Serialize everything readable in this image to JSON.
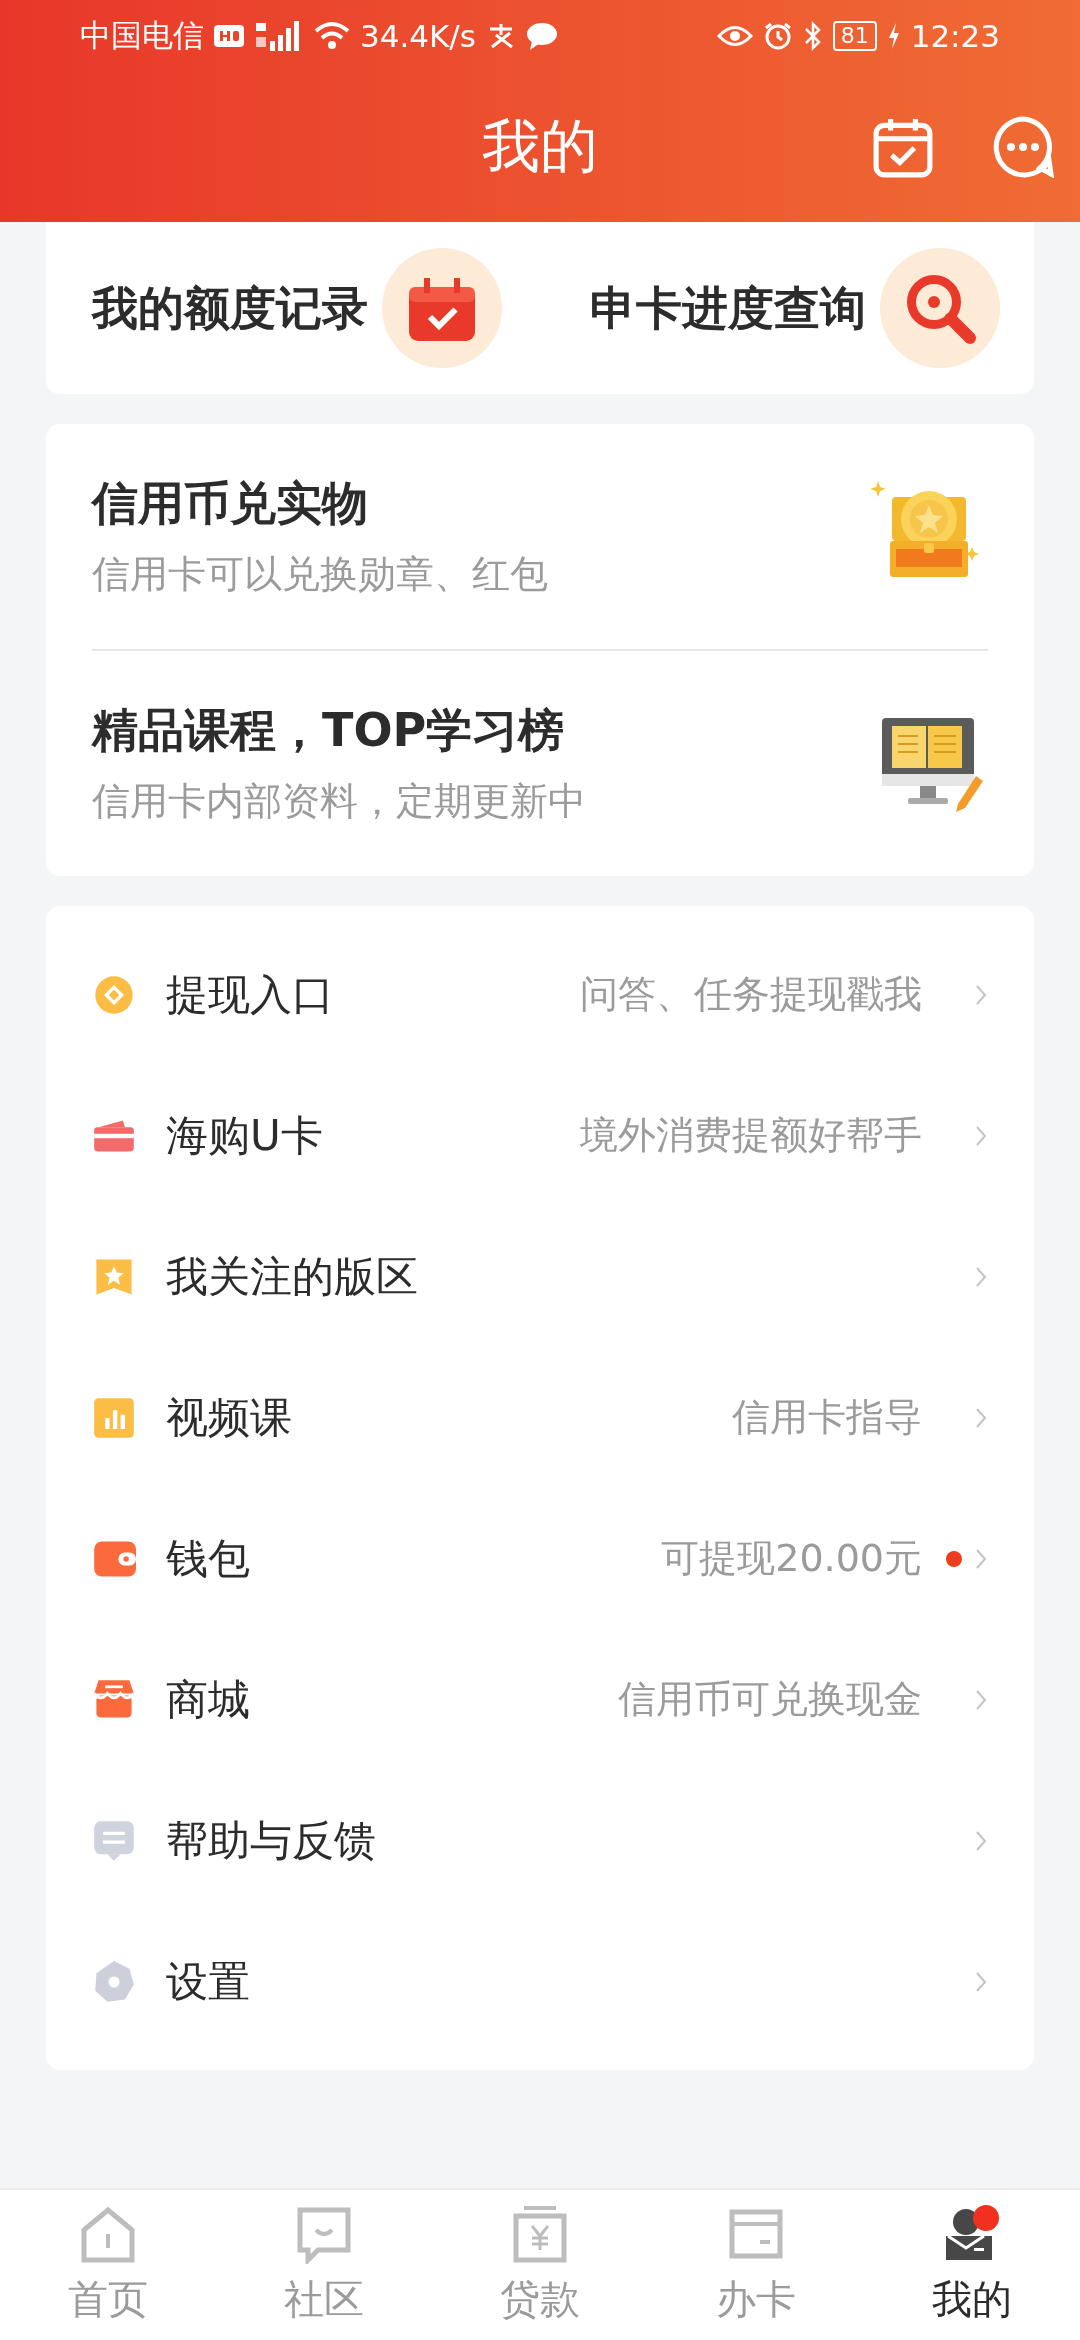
{
  "status_bar": {
    "carrier": "中国电信",
    "speed": "34.4K/s",
    "battery": "81",
    "time": "12:23"
  },
  "header": {
    "title": "我的"
  },
  "quick_cards": [
    {
      "title": "我的额度记录"
    },
    {
      "title": "申卡进度查询"
    }
  ],
  "promos": [
    {
      "title": "信用币兑实物",
      "subtitle": "信用卡可以兑换勋章、红包"
    },
    {
      "title": "精品课程，TOP学习榜",
      "subtitle": "信用卡内部资料，定期更新中"
    }
  ],
  "menu": [
    {
      "label": "提现入口",
      "hint": "问答、任务提现戳我",
      "dot": false
    },
    {
      "label": "海购U卡",
      "hint": "境外消费提额好帮手",
      "dot": false
    },
    {
      "label": "我关注的版区",
      "dot": false
    },
    {
      "label": "视频课",
      "hint": "信用卡指导",
      "dot": false
    },
    {
      "label": "钱包",
      "hint": "可提现20.00元",
      "dot": true
    },
    {
      "label": "商城",
      "hint": "信用币可兑换现金",
      "dot": false
    },
    {
      "label": "帮助与反馈",
      "dot": false
    },
    {
      "label": "设置",
      "dot": false
    }
  ],
  "tab_bar": [
    {
      "label": "首页",
      "selected": false
    },
    {
      "label": "社区",
      "selected": false
    },
    {
      "label": "贷款",
      "selected": false
    },
    {
      "label": "办卡",
      "selected": false
    },
    {
      "label": "我的",
      "selected": true
    }
  ]
}
